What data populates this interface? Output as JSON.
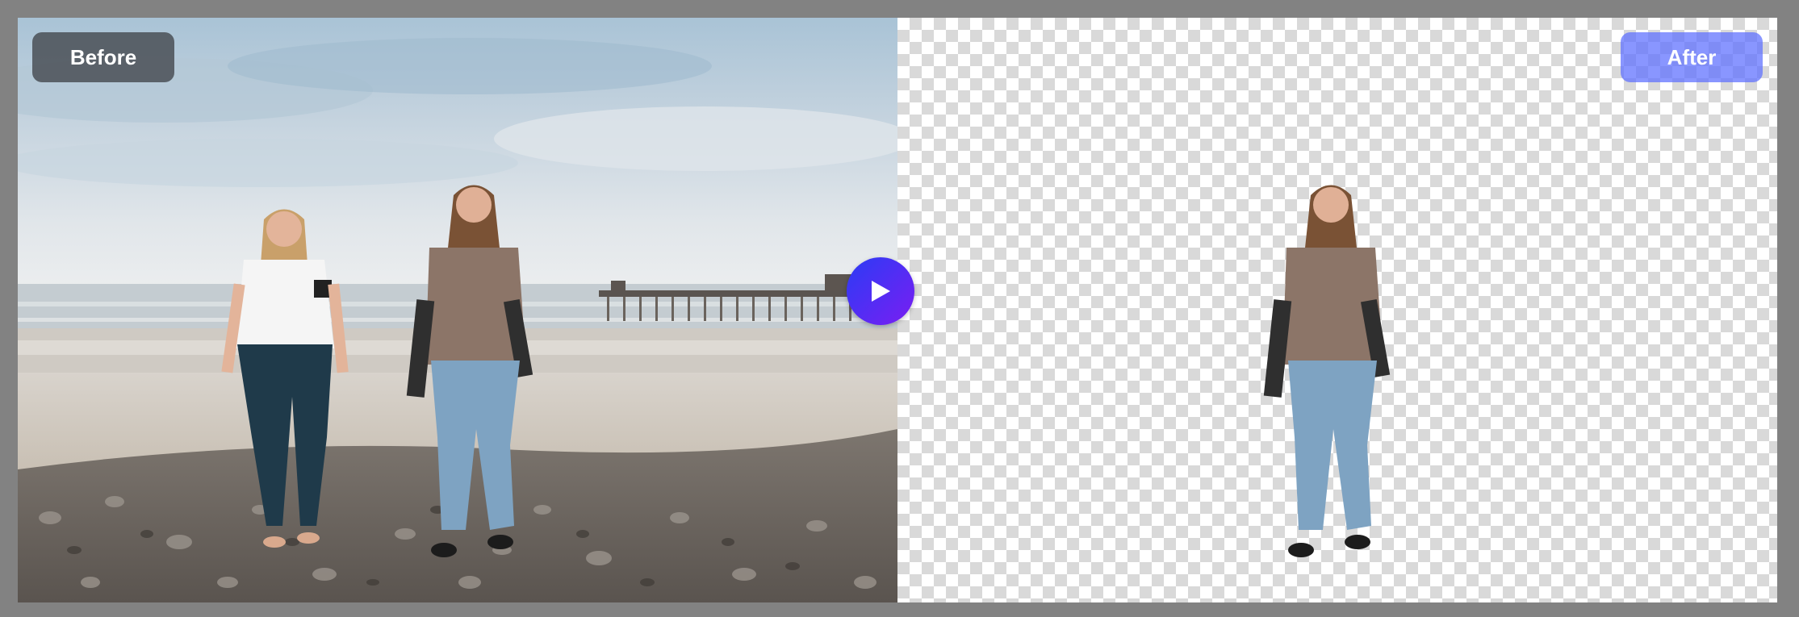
{
  "labels": {
    "before": "Before",
    "after": "After"
  },
  "compare_button": {
    "icon": "play-icon",
    "gradient_start": "#2b3cf5",
    "gradient_end": "#7a1ef2"
  },
  "colors": {
    "frame": "#7d7d7d",
    "before_badge": "#464b50",
    "after_badge": "#5c6eff",
    "checker_dark": "#d9d9d9",
    "checker_light": "#ffffff"
  }
}
